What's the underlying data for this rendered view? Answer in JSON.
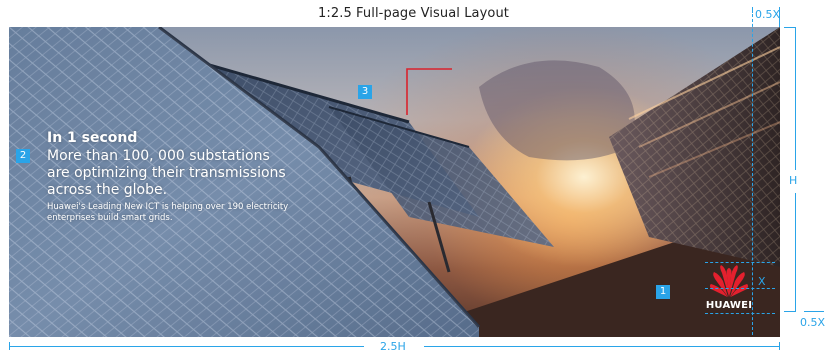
{
  "title": "1:2.5 Full-page Visual Layout",
  "copy": {
    "headline": "In 1 second",
    "body_lines": [
      "More than 100, 000 substations",
      "are optimizing their transmissions",
      "across the globe."
    ],
    "small_lines": [
      "Huawei's Leading New ICT is helping over 190 electricity",
      "enterprises build smart grids."
    ]
  },
  "badges": {
    "one": "1",
    "two": "2",
    "three": "3"
  },
  "logo": {
    "wordmark": "HUAWEI",
    "icon": "huawei-petal-icon"
  },
  "dimensions": {
    "top_margin": "0.5X",
    "height": "H",
    "bottom_margin": "0.5X",
    "logo_size": "X",
    "width": "2.5H"
  },
  "colors": {
    "annotation": "#2aa4e8",
    "badge": "#2aa4e8",
    "title_block_marker": "#d9232d",
    "logo": "#e4202e"
  }
}
